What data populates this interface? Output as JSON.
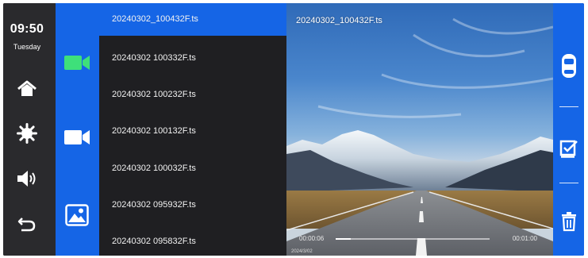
{
  "status": {
    "time": "09:50",
    "day": "Tuesday"
  },
  "left_nav": [
    {
      "icon": "home-icon"
    },
    {
      "icon": "settings-icon"
    },
    {
      "icon": "volume-icon"
    },
    {
      "icon": "back-icon"
    }
  ],
  "categories": [
    {
      "icon": "front-camera-icon",
      "color": "#3ee07a",
      "selected": true
    },
    {
      "icon": "rear-camera-icon",
      "color": "#ffffff",
      "selected": false
    },
    {
      "icon": "photo-icon",
      "color": "#ffffff",
      "selected": false
    }
  ],
  "files": [
    {
      "name": "20240302_100432F.ts",
      "selected": true
    },
    {
      "name": "20240302 100332F.ts",
      "selected": false
    },
    {
      "name": "20240302 100232F.ts",
      "selected": false
    },
    {
      "name": "20240302 100132F.ts",
      "selected": false
    },
    {
      "name": "20240302 100032F.ts",
      "selected": false
    },
    {
      "name": "20240302 095932F.ts",
      "selected": false
    },
    {
      "name": "20240302 095832F.ts",
      "selected": false
    }
  ],
  "preview": {
    "title": "20240302_100432F.ts",
    "current_time": "00:00:06",
    "total_time": "00:01:00",
    "date_stamp": "2024/3/02",
    "progress": 0.1
  },
  "right_actions": [
    {
      "icon": "car-icon"
    },
    {
      "icon": "select-icon"
    },
    {
      "icon": "delete-icon"
    }
  ],
  "colors": {
    "accent": "#1565e6",
    "panel": "#1f1f22",
    "sidebar": "#2a2a2d",
    "highlight": "#3ee07a"
  }
}
